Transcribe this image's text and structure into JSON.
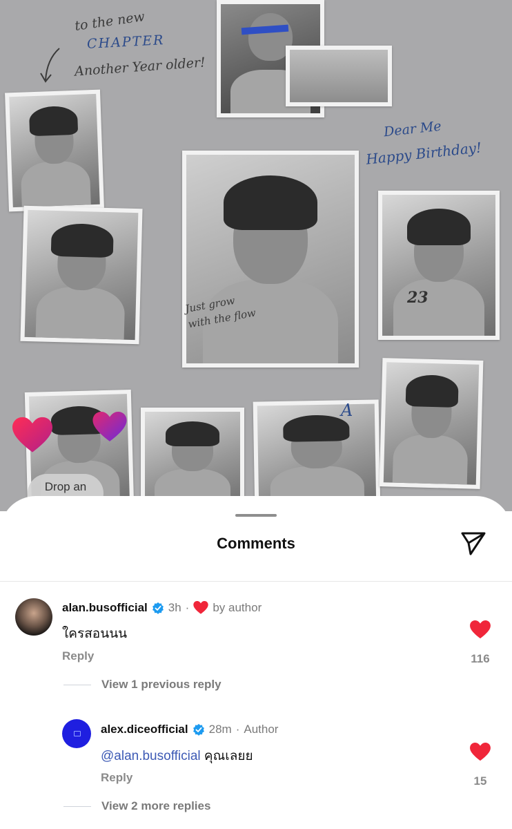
{
  "collage": {
    "notes": {
      "to_the_new": "to the new",
      "chapter": "CHAPTER",
      "another_year": "Another Year older!",
      "dear_me": "Dear Me",
      "happy_birthday": "Happy Birthday!",
      "just_grow": "Just grow",
      "with_the_flow": "with the flow",
      "letter_a": "A",
      "cake_number": "23"
    },
    "drop_pill": "Drop an"
  },
  "sheet": {
    "title": "Comments"
  },
  "comments": [
    {
      "username": "alan.busofficial",
      "time": "3h",
      "separator": "·",
      "liked_by": "by author",
      "text": "ใครสอนนน",
      "reply_label": "Reply",
      "likes": "116",
      "view_replies": "View 1 previous reply"
    },
    {
      "username": "alex.diceofficial",
      "time": "28m",
      "separator": "·",
      "role": "Author",
      "mention": "@alan.busofficial",
      "text": "คุณเลยย",
      "reply_label": "Reply",
      "likes": "15",
      "view_replies": "View 2 more replies"
    }
  ],
  "colors": {
    "heart_red": "#f0263a",
    "verified_blue": "#1d9bf0",
    "mention_blue": "#3d5ab5",
    "author_avatar": "#1f1fe0"
  }
}
